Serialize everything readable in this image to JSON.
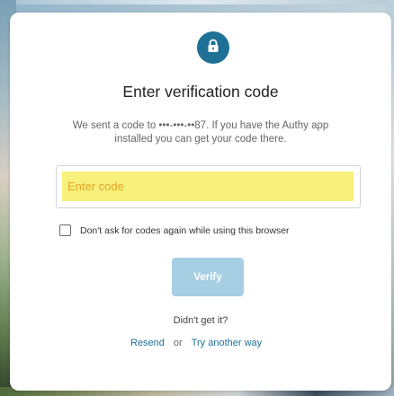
{
  "dialog": {
    "icon": "lock-icon",
    "title": "Enter verification code",
    "description": "We sent a code to •••-•••-••87. If you have the Authy app installed you can get your code there."
  },
  "code_input": {
    "placeholder": "Enter code",
    "value": ""
  },
  "remember": {
    "label": "Don't ask for codes again while using this browser",
    "checked": false
  },
  "verify_button": {
    "label": "Verify"
  },
  "help": {
    "prompt": "Didn't get it?",
    "resend_label": "Resend",
    "or_label": "or",
    "try_another_label": "Try another way"
  },
  "colors": {
    "accent": "#1e7097",
    "verify_disabled": "#a7cfe4",
    "input_highlight": "#f7f07a",
    "placeholder": "#e3a52a"
  }
}
